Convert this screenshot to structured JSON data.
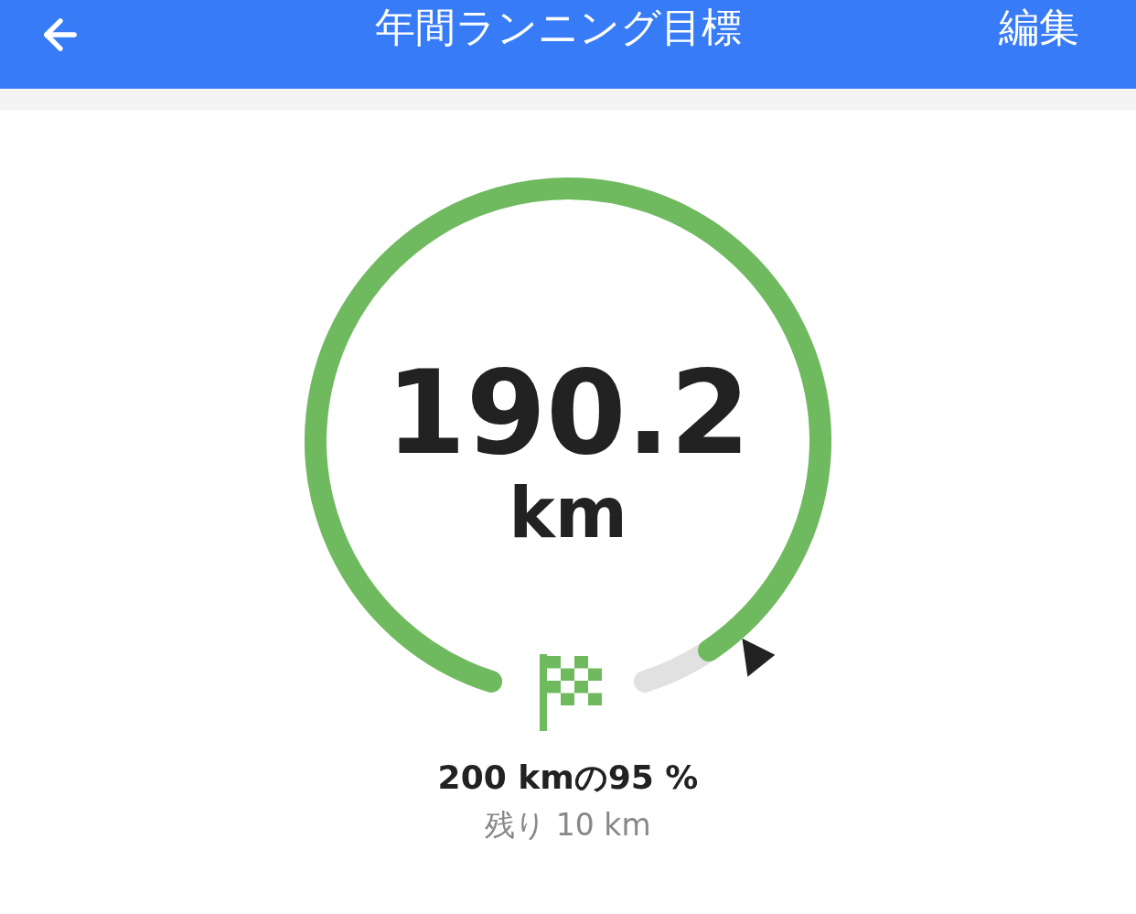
{
  "header": {
    "title": "年間ランニング目標",
    "action": "編集"
  },
  "goal": {
    "distance": "190.2",
    "unit": "km",
    "summary": "200 kmの95 %",
    "remaining": "残り 10 km"
  }
}
